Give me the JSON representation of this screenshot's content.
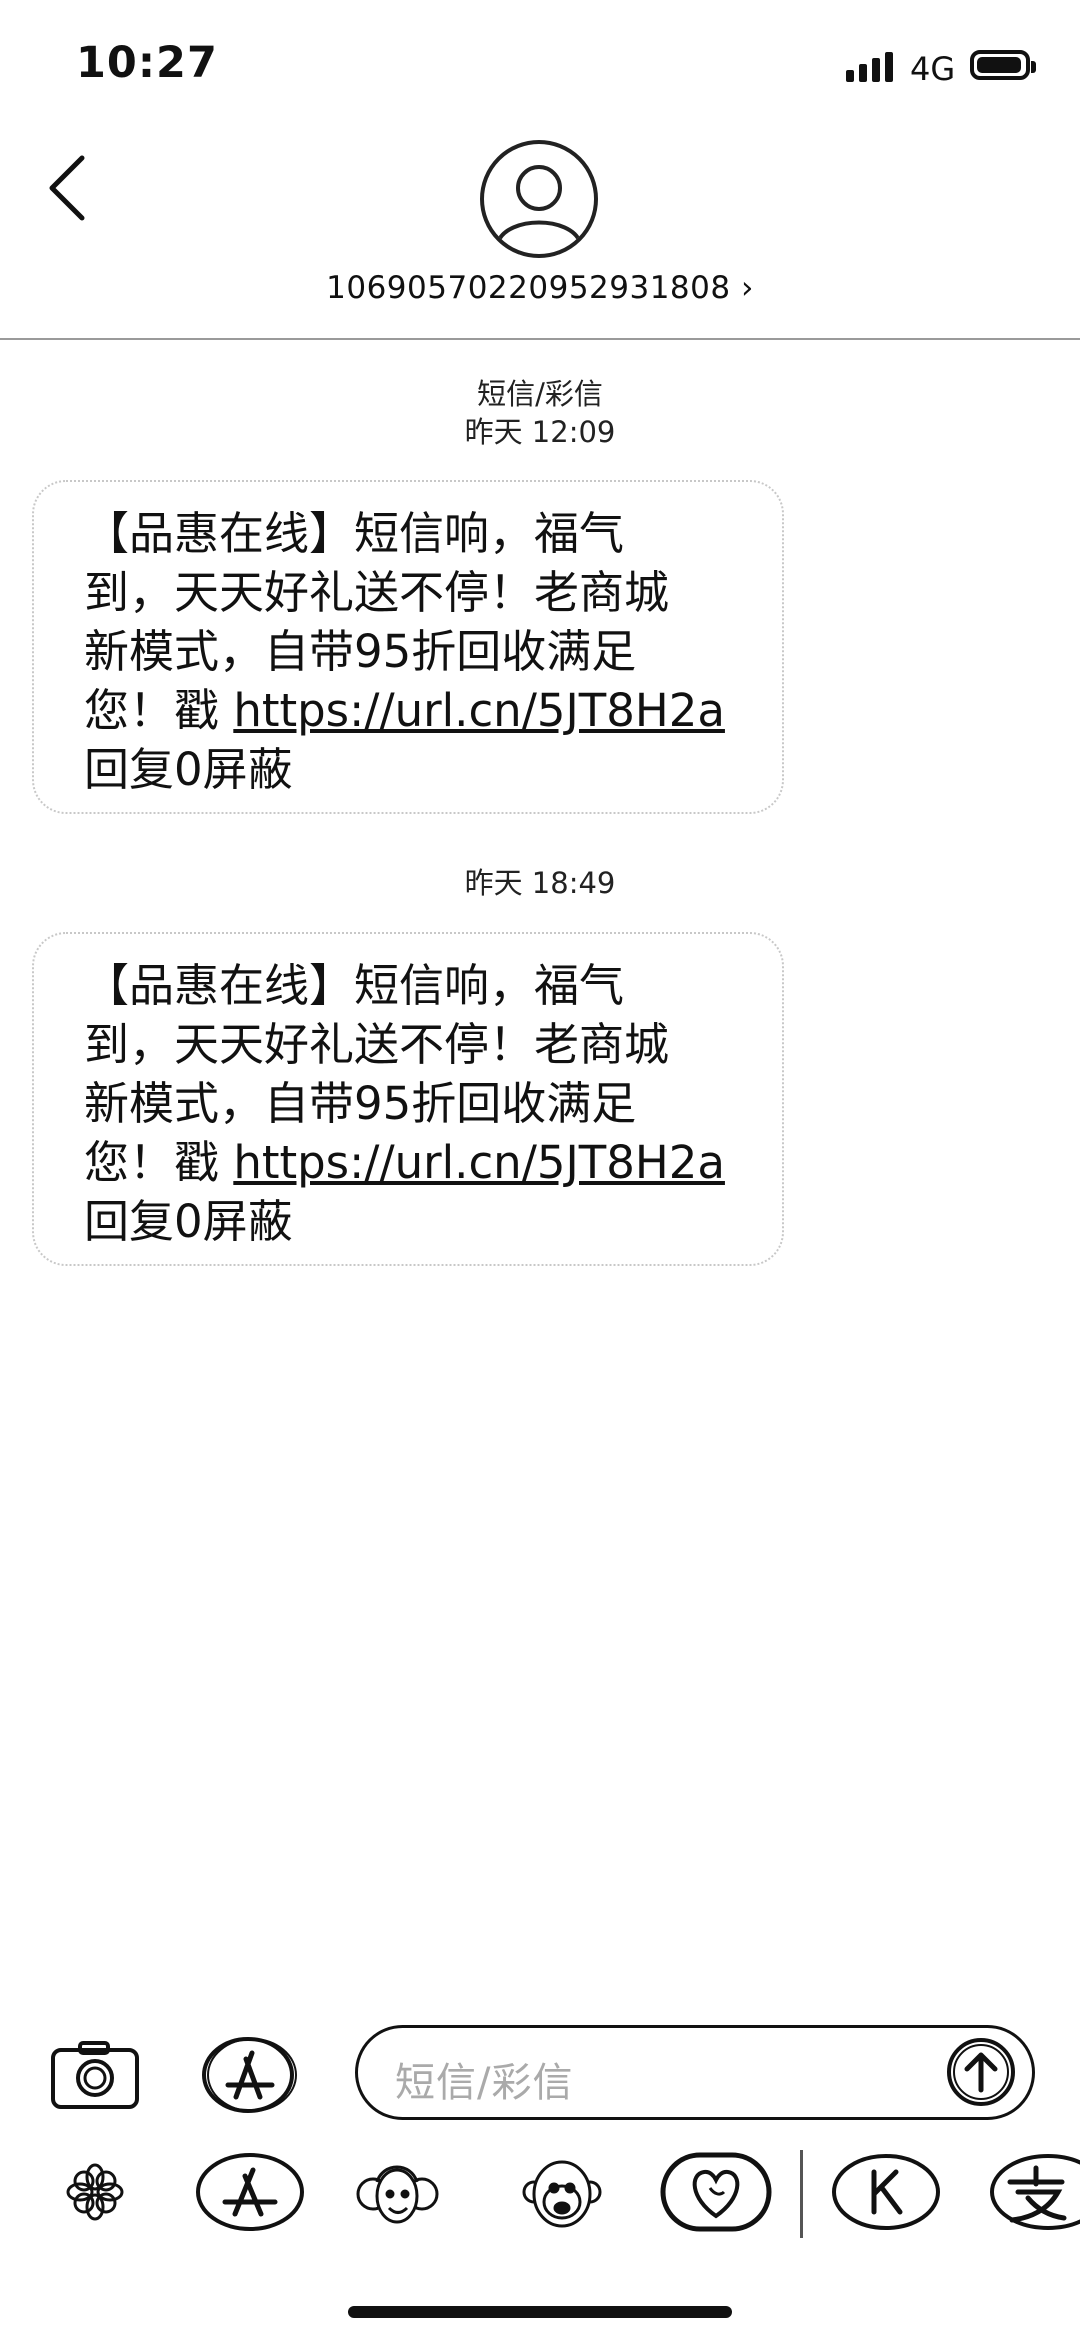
{
  "status_bar": {
    "time": "10:27",
    "network": "4G",
    "signal_bars": 4,
    "battery_level": 0.95
  },
  "header": {
    "contact_number": "10690570220952931808 ›"
  },
  "thread": {
    "channel_label": "短信/彩信",
    "messages": [
      {
        "timestamp": "昨天 12:09",
        "text_before_link": "【品惠在线】短信响，福气\n到，天天好礼送不停！老商城\n新模式，自带95折回收满足\n您！戳 ",
        "link": "https://url.cn/5JT8H2a",
        "text_after_link": "\n回复0屏蔽"
      },
      {
        "timestamp": "昨天 18:49",
        "text_before_link": "【品惠在线】短信响，福气\n到，天天好礼送不停！老商城\n新模式，自带95折回收满足\n您！戳 ",
        "link": "https://url.cn/5JT8H2a",
        "text_after_link": "\n回复0屏蔽"
      }
    ]
  },
  "composer": {
    "placeholder": "短信/彩信"
  },
  "icons": {
    "back": "chevron-left-icon",
    "avatar": "person-icon",
    "camera": "camera-icon",
    "apps": "app-store-icon",
    "send": "arrow-up-icon",
    "drawer": [
      "photos-icon",
      "app-store-icon",
      "memoji-icon",
      "animoji-icon",
      "digital-touch-icon",
      "k-app-icon",
      "alipay-icon"
    ]
  }
}
